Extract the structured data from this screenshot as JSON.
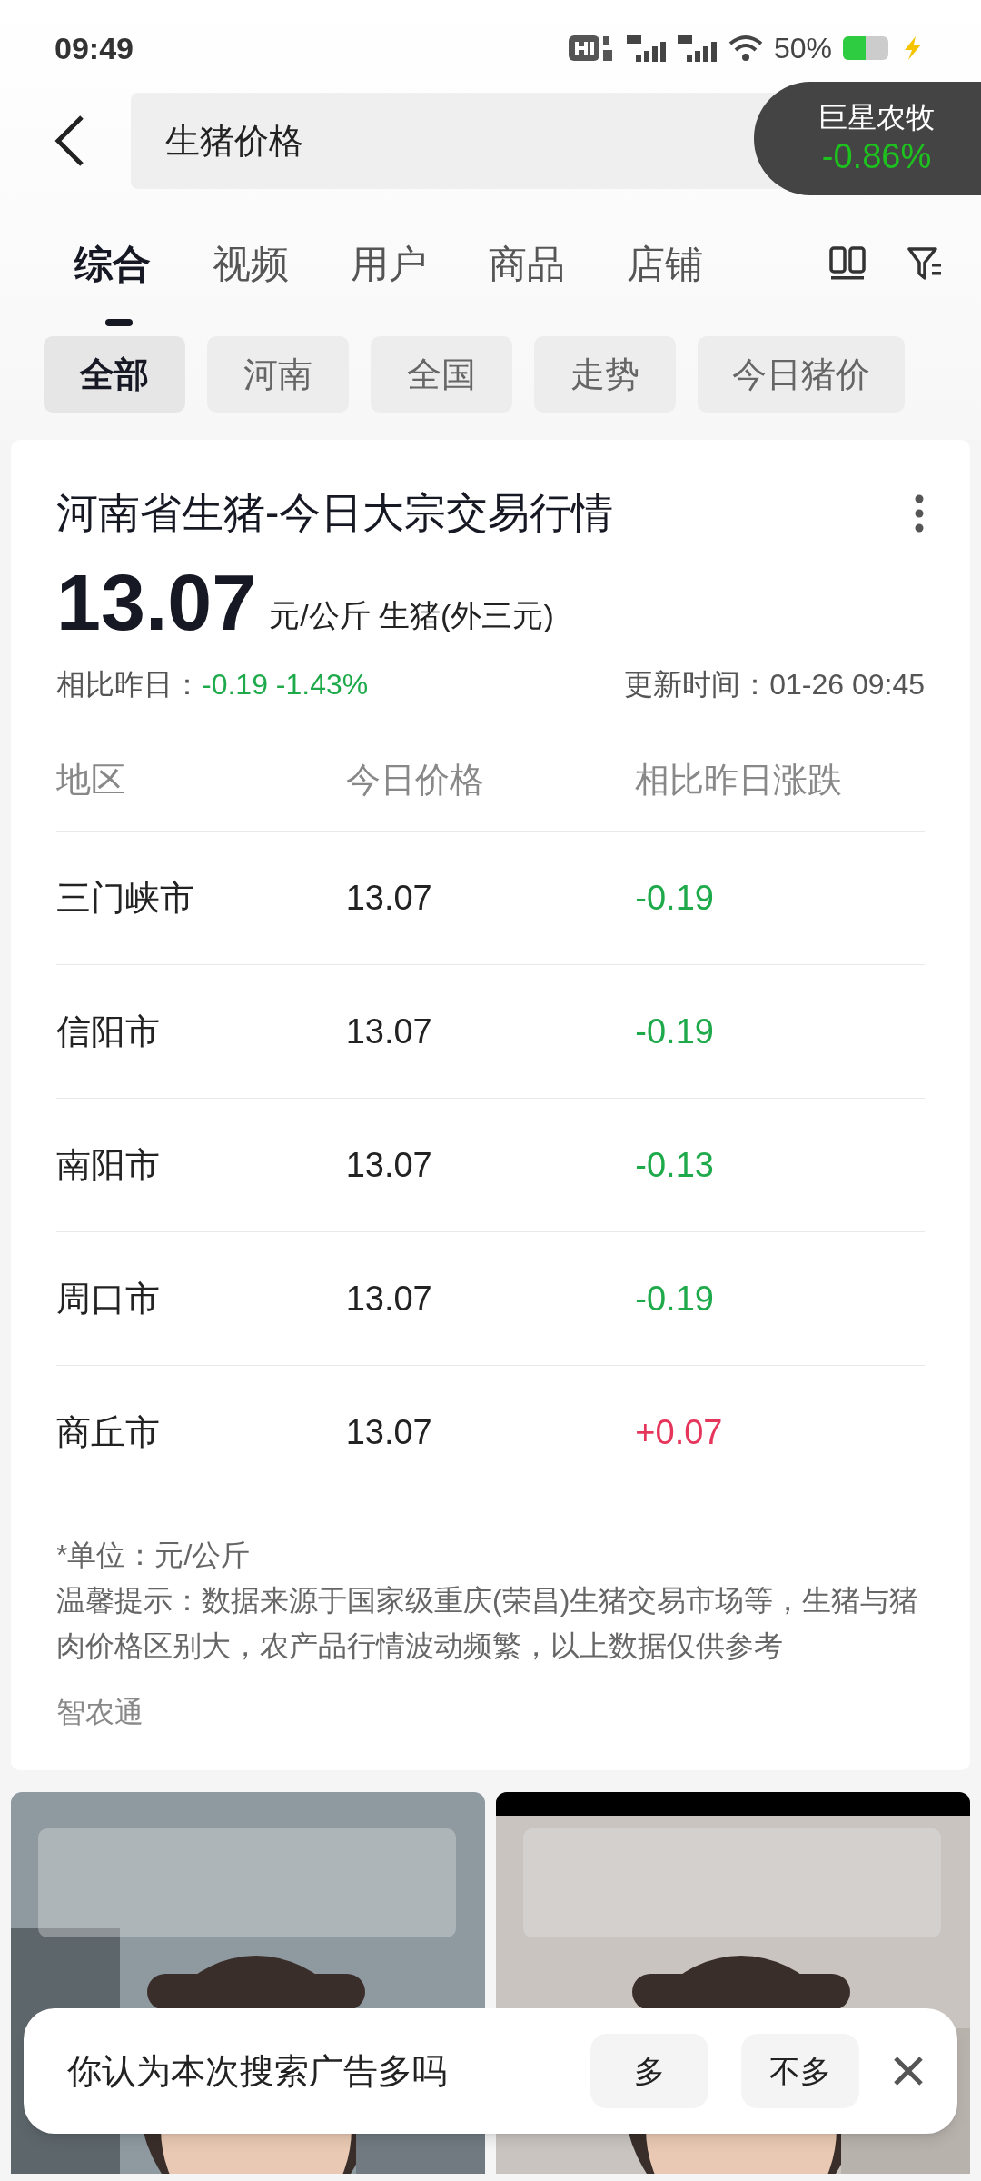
{
  "status_bar": {
    "time": "09:49",
    "battery_text": "50%"
  },
  "search": {
    "query": "生猪价格"
  },
  "stock_overlay": {
    "name": "巨星农牧",
    "change": "-0.86%"
  },
  "tabs": [
    {
      "label": "综合",
      "selected": true
    },
    {
      "label": "视频",
      "selected": false
    },
    {
      "label": "用户",
      "selected": false
    },
    {
      "label": "商品",
      "selected": false
    },
    {
      "label": "店铺",
      "selected": false
    }
  ],
  "chips": [
    {
      "label": "全部",
      "selected": true
    },
    {
      "label": "河南",
      "selected": false
    },
    {
      "label": "全国",
      "selected": false
    },
    {
      "label": "走势",
      "selected": false
    },
    {
      "label": "今日猪价",
      "selected": false
    }
  ],
  "card": {
    "title": "河南省生猪-今日大宗交易行情",
    "price": "13.07",
    "unit": "元/公斤 生猪(外三元)",
    "compare_label": "相比昨日：",
    "compare_value": "-0.19 -1.43%",
    "updated": "更新时间：01-26 09:45",
    "table": {
      "columns": [
        "地区",
        "今日价格",
        "相比昨日涨跌"
      ],
      "rows": [
        {
          "region": "三门峡市",
          "price": "13.07",
          "change": "-0.19",
          "color": "#1eaa4a"
        },
        {
          "region": "信阳市",
          "price": "13.07",
          "change": "-0.19",
          "color": "#1eaa4a"
        },
        {
          "region": "南阳市",
          "price": "13.07",
          "change": "-0.13",
          "color": "#1eaa4a"
        },
        {
          "region": "周口市",
          "price": "13.07",
          "change": "-0.19",
          "color": "#1eaa4a"
        },
        {
          "region": "商丘市",
          "price": "13.07",
          "change": "+0.07",
          "color": "#e5355b"
        }
      ]
    },
    "unit_note": "*单位：元/公斤",
    "notice": "温馨提示：数据来源于国家级重庆(荣昌)生猪交易市场等，生猪与猪肉价格区别大，农产品行情波动频繁，以上数据仅供参考",
    "source": "智农通"
  },
  "survey": {
    "question": "你认为本次搜索广告多吗",
    "options": [
      "多",
      "不多"
    ]
  }
}
